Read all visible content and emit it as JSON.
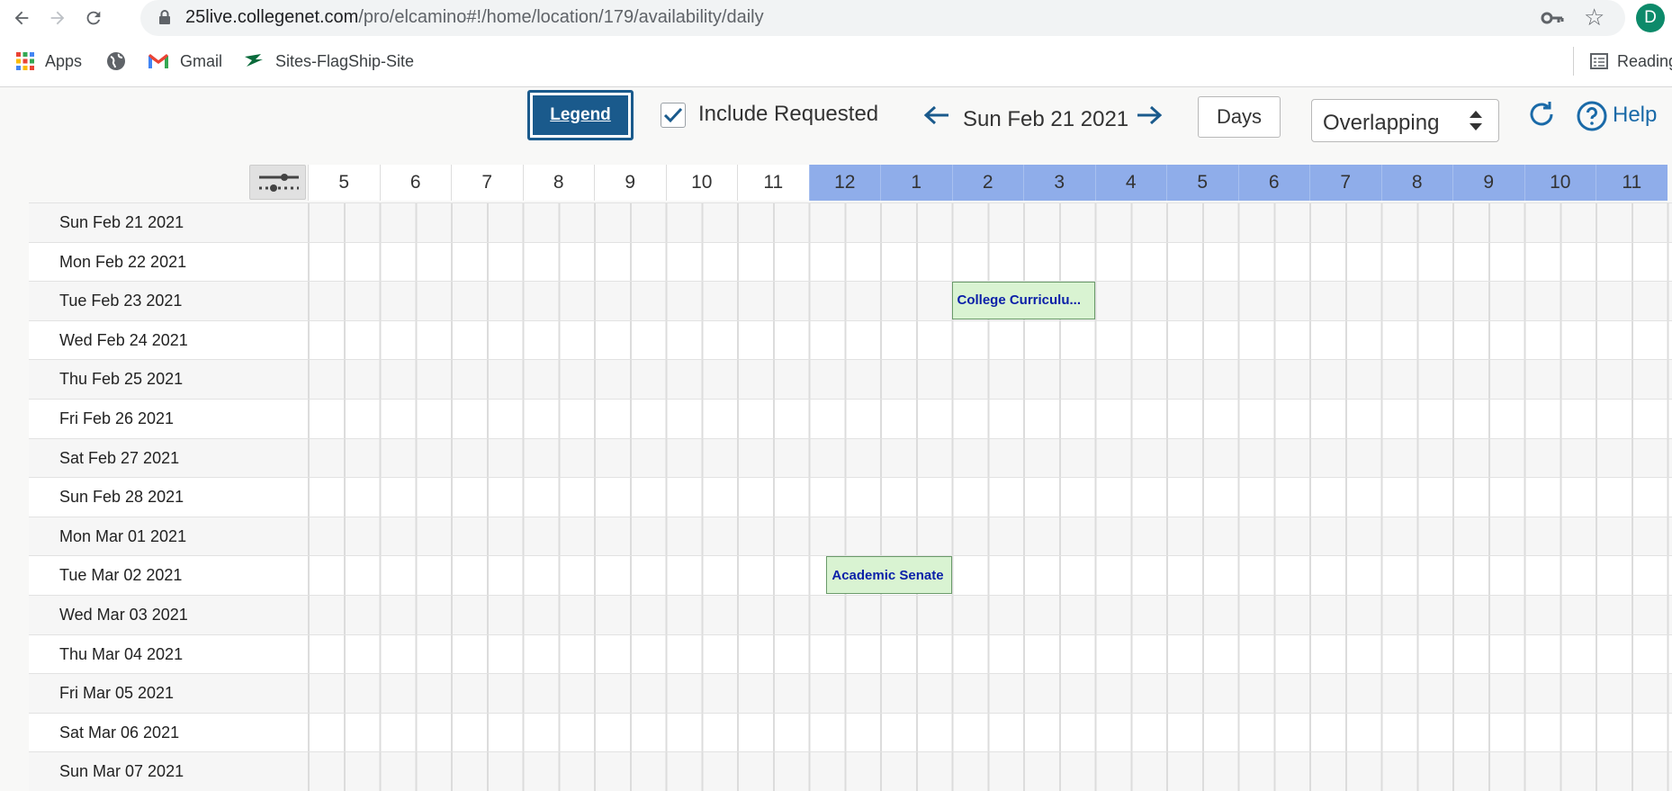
{
  "browser": {
    "url_host": "25live.collegenet.com",
    "url_path": "/pro/elcamino#!/home/location/179/availability/daily",
    "profile_initial": "D",
    "bookmarks": [
      "Apps",
      "Gmail",
      "Sites-FlagShip-Site"
    ],
    "reading_list_label": "Reading"
  },
  "toolbar": {
    "legend_label": "Legend",
    "include_requested_label": "Include Requested",
    "include_requested_checked": true,
    "current_date": "Sun Feb 21 2021",
    "view_button_label": "Days",
    "mode_select_value": "Overlapping",
    "help_label": "Help"
  },
  "grid": {
    "hours": [
      "5",
      "6",
      "7",
      "8",
      "9",
      "10",
      "11",
      "12",
      "1",
      "2",
      "3",
      "4",
      "5",
      "6",
      "7",
      "8",
      "9",
      "10",
      "11"
    ],
    "pm_start_index": 7,
    "days": [
      "Sun Feb 21 2021",
      "Mon Feb 22 2021",
      "Tue Feb 23 2021",
      "Wed Feb 24 2021",
      "Thu Feb 25 2021",
      "Fri Feb 26 2021",
      "Sat Feb 27 2021",
      "Sun Feb 28 2021",
      "Mon Mar 01 2021",
      "Tue Mar 02 2021",
      "Wed Mar 03 2021",
      "Thu Mar 04 2021",
      "Fri Mar 05 2021",
      "Sat Mar 06 2021",
      "Sun Mar 07 2021"
    ],
    "events": [
      {
        "label": "College Curriculu...",
        "day": "Tue Feb 23 2021",
        "start": "2:00 PM",
        "end": "4:00 PM"
      },
      {
        "label": "Academic Senate",
        "day": "Tue Mar 02 2021",
        "start": "12:15 PM",
        "end": "2:00 PM"
      }
    ]
  },
  "colors": {
    "pm_header": "#8fadea",
    "event_fill": "#d9f3d2",
    "event_text": "#0a1fa8",
    "legend_button": "#1a5a8c",
    "accent": "#1a6aa8"
  }
}
